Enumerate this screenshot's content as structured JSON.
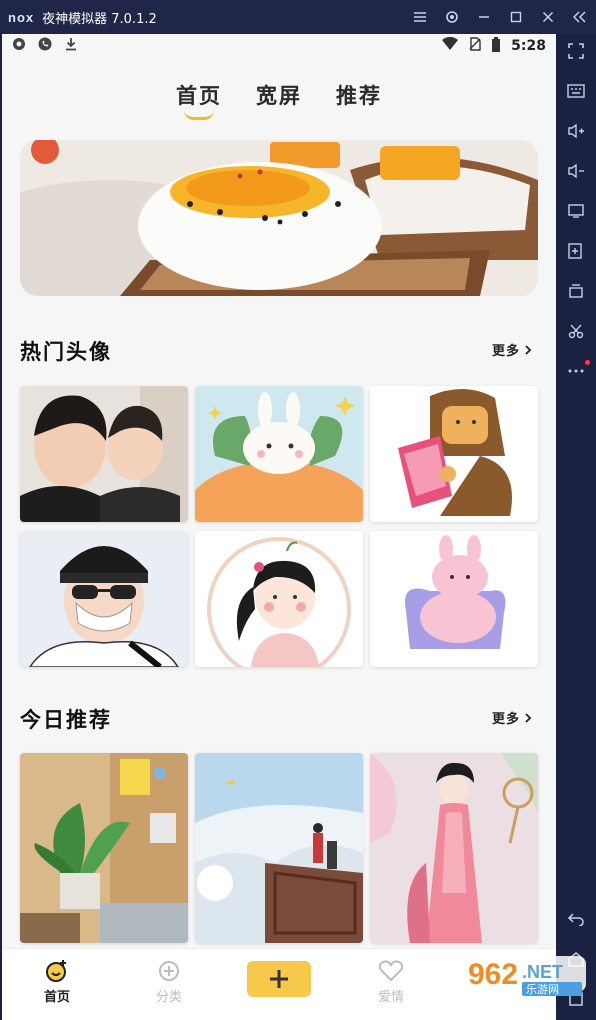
{
  "window": {
    "logo_text": "nox",
    "title": "夜神模拟器 7.0.1.2"
  },
  "status_bar": {
    "time": "5:28"
  },
  "top_tabs": [
    {
      "label": "首页",
      "active": true
    },
    {
      "label": "宽屏",
      "active": false
    },
    {
      "label": "推荐",
      "active": false
    }
  ],
  "hot_avatars": {
    "title": "热门头像",
    "more_label": "更多"
  },
  "today_recommend": {
    "title": "今日推荐",
    "more_label": "更多"
  },
  "bottom_nav": {
    "home_label": "首页",
    "category_label": "分类",
    "love_label": "爱情"
  },
  "watermark": {
    "number": "962",
    "suffix": ".NET",
    "sub": "乐游网"
  },
  "colors": {
    "accent": "#f4b92b",
    "plus_button": "#f6c94b",
    "emulator_chrome": "#1f2647"
  }
}
